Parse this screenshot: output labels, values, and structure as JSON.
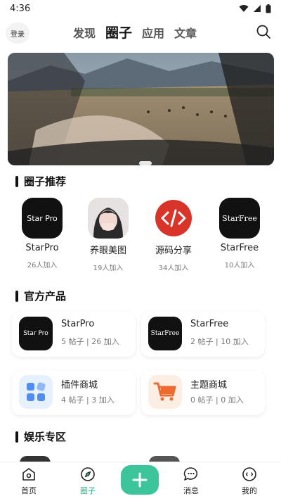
{
  "status": {
    "time": "4:36"
  },
  "header": {
    "login_label": "登录",
    "tabs": [
      {
        "label": "发现",
        "active": false
      },
      {
        "label": "圈子",
        "active": true
      },
      {
        "label": "应用",
        "active": false
      },
      {
        "label": "文章",
        "active": false
      }
    ]
  },
  "sections": {
    "recommended_title": "圈子推荐",
    "products_title": "官方产品",
    "entertainment_title": "娱乐专区"
  },
  "recommended": [
    {
      "name": "StarPro",
      "count": "26人加入",
      "icon_text": "Star Pro"
    },
    {
      "name": "养眼美图",
      "count": "19人加入",
      "icon_text": ""
    },
    {
      "name": "源码分享",
      "count": "34人加入",
      "icon_text": "</>"
    },
    {
      "name": "StarFree",
      "count": "10人加入",
      "icon_text": "StarFree"
    }
  ],
  "products": [
    {
      "name": "StarPro",
      "meta": "5 帖子 | 26 加入",
      "icon_text": "Star Pro"
    },
    {
      "name": "StarFree",
      "meta": "2 帖子 | 10 加入",
      "icon_text": "StarFree"
    },
    {
      "name": "插件商城",
      "meta": "4 帖子 | 3 加入",
      "icon_text": ""
    },
    {
      "name": "主题商城",
      "meta": "0 帖子 | 0 加入",
      "icon_text": ""
    }
  ],
  "bottom_nav": [
    {
      "label": "首页",
      "icon": "home-icon",
      "active": false
    },
    {
      "label": "圈子",
      "icon": "compass-icon",
      "active": true
    },
    {
      "label": "消息",
      "icon": "chat-icon",
      "active": false
    },
    {
      "label": "我的",
      "icon": "profile-icon",
      "active": false
    }
  ],
  "colors": {
    "accent": "#3cc59a",
    "active_nav": "#36b58a",
    "code_red": "#d8342a"
  }
}
